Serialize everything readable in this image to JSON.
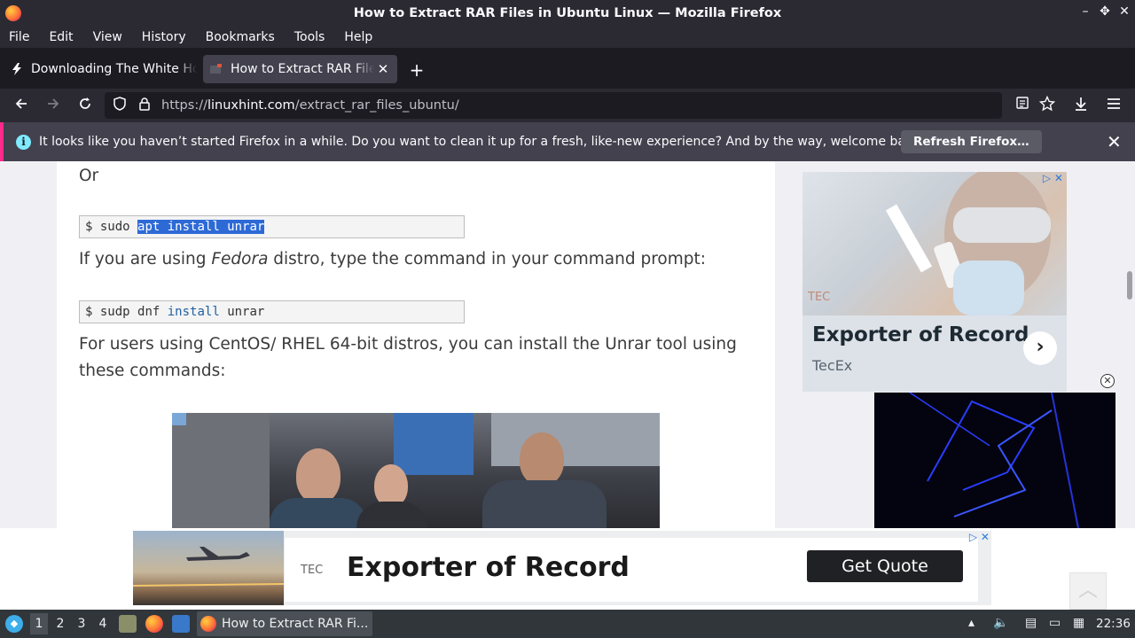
{
  "window": {
    "title": "How to Extract RAR Files in Ubuntu Linux — Mozilla Firefox",
    "controls": {
      "minimize": "–",
      "maximize": "✥",
      "close": "✕"
    }
  },
  "menu": [
    "File",
    "Edit",
    "View",
    "History",
    "Bookmarks",
    "Tools",
    "Help"
  ],
  "tabs": [
    {
      "label": "Downloading The White House",
      "icon": "lightning-icon",
      "active": false
    },
    {
      "label": "How to Extract RAR Files in Ubuntu Linux",
      "icon": "linuxhint-favicon",
      "active": true,
      "close": "✕"
    }
  ],
  "new_tab_label": "+",
  "url": {
    "protocol": "https://",
    "domain": "linuxhint.com",
    "path": "/extract_rar_files_ubuntu/"
  },
  "notification": {
    "message": "It looks like you haven’t started Firefox in a while. Do you want to clean it up for a fresh, like-new experience? And by the way, welcome back!",
    "button": "Refresh Firefox…",
    "close": "✕"
  },
  "article": {
    "or_text": "Or",
    "code1": {
      "prompt": "$",
      "cmd1": "sudo",
      "selected": "apt install unrar"
    },
    "fedora_pre": "If you are using ",
    "fedora_em": "Fedora",
    "fedora_post": " distro, type the command in your command prompt:",
    "code2": {
      "prompt": "$",
      "cmd1": "sudp dnf",
      "kw": "install",
      "rest": "unrar"
    },
    "centos_line1": "For users using CentOS/ RHEL 64-bit distros, you can install the Unrar tool using",
    "centos_line2": "these commands:"
  },
  "sidebar_ad": {
    "logo": "TEC",
    "title": "Exporter of Record",
    "subtitle": "TecEx",
    "arrow": "›",
    "close_mark": "▷ ✕"
  },
  "video_close": "✕",
  "banner_ad": {
    "logo": "TEC",
    "title": "Exporter of Record",
    "cta": "Get Quote",
    "close_mark": "▷ ✕",
    "scroll_top": "︿"
  },
  "taskbar": {
    "workspaces": [
      "1",
      "2",
      "3",
      "4"
    ],
    "active_workspace": "1",
    "task_label": "How to Extract RAR Fi...",
    "clock": "22:36"
  },
  "colors": {
    "selection": "#2d6ad6",
    "notification_accent": "#ff2a8a",
    "info_icon": "#80ebff"
  }
}
